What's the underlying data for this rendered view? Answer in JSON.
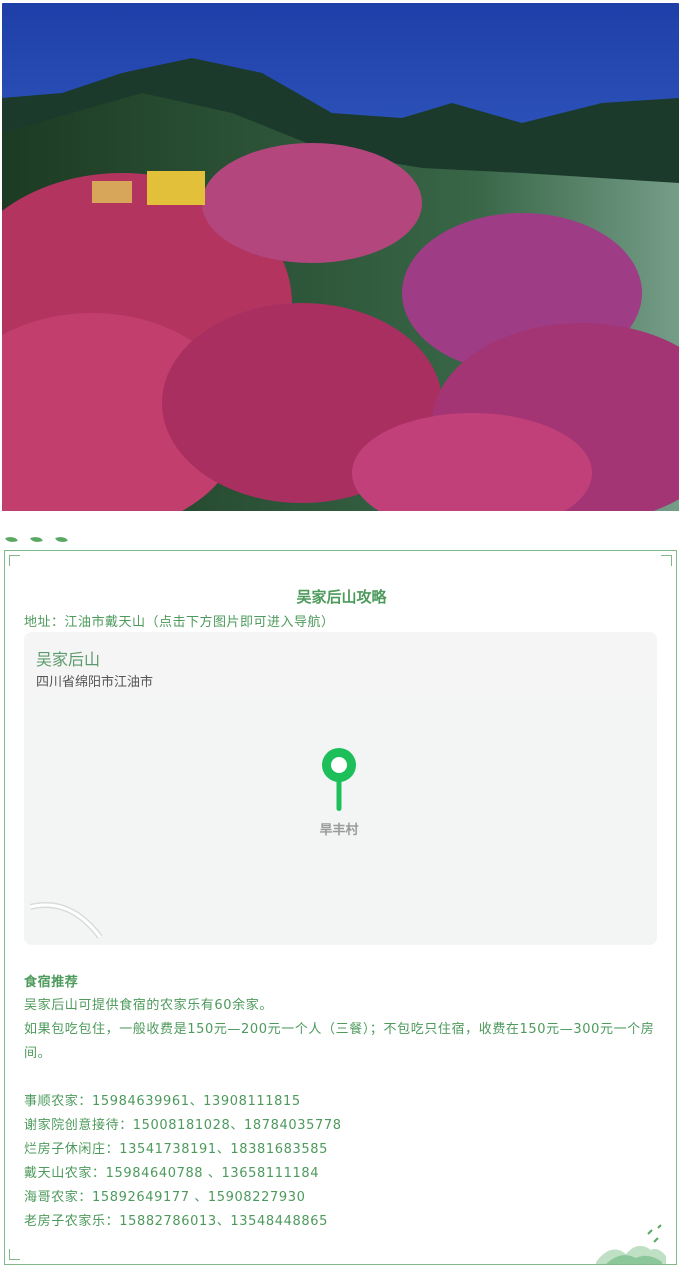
{
  "hero": {
    "description_icon": "mountain-flower-landscape"
  },
  "card": {
    "title": "吴家后山攻略",
    "address": "地址：江油市戴天山（点击下方图片即可进入导航）"
  },
  "map": {
    "place_name": "吴家后山",
    "place_address": "四川省绵阳市江油市",
    "pin_label": "旱丰村",
    "pin_color": "#1dbf5a",
    "pin_icon": "location-pin-icon"
  },
  "lodging": {
    "heading": "食宿推荐",
    "intro": "吴家后山可提供食宿的农家乐有60余家。",
    "pricing": "如果包吃包住，一般收费是150元—200元一个人（三餐）；不包吃只住宿，收费在150元—300元一个房间。",
    "contacts": [
      "事顺农家：15984639961、13908111815",
      "谢家院创意接待：15008181028、18784035778",
      "烂房子休闲庄：13541738191、18381683585",
      "戴天山农家：15984640788 、13658111184",
      "海哥农家：15892649177 、15908227930",
      "老房子农家乐：15882786013、13548448865"
    ]
  },
  "colors": {
    "accent": "#4d9a5c",
    "border": "#7fb889"
  }
}
